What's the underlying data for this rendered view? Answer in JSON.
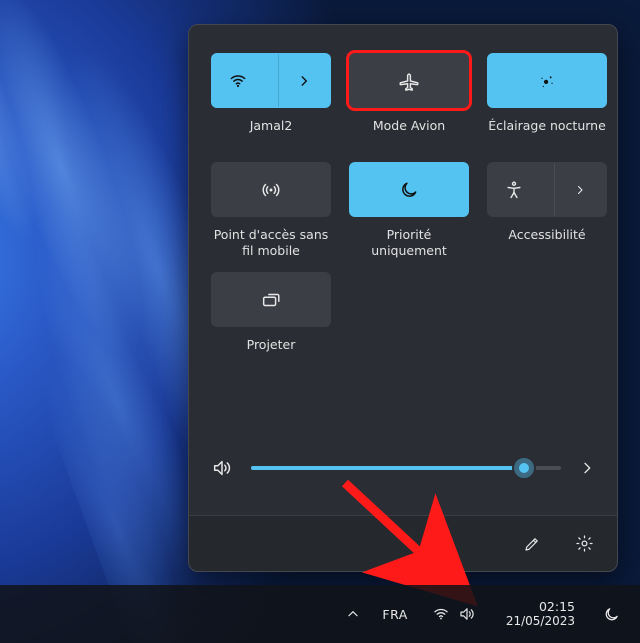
{
  "taskbar": {
    "language": "FRA",
    "clock": {
      "time": "02:15",
      "date": "21/05/2023"
    }
  },
  "quick_settings": {
    "tiles": [
      {
        "id": "wifi",
        "label": "Jamal2",
        "active": true,
        "split": true,
        "highlighted": false,
        "icon": "wifi-icon"
      },
      {
        "id": "airplane",
        "label": "Mode Avion",
        "active": false,
        "split": false,
        "highlighted": true,
        "icon": "airplane-icon"
      },
      {
        "id": "night-light",
        "label": "Éclairage nocturne",
        "active": true,
        "split": false,
        "highlighted": false,
        "icon": "night-light-icon"
      },
      {
        "id": "hotspot",
        "label": "Point d'accès sans fil mobile",
        "active": false,
        "split": false,
        "highlighted": false,
        "icon": "hotspot-icon"
      },
      {
        "id": "focus",
        "label": "Priorité uniquement",
        "active": true,
        "split": false,
        "highlighted": false,
        "icon": "moon-icon"
      },
      {
        "id": "accessibility",
        "label": "Accessibilité",
        "active": false,
        "split": true,
        "highlighted": false,
        "icon": "accessibility-icon"
      },
      {
        "id": "project",
        "label": "Projeter",
        "active": false,
        "split": false,
        "highlighted": false,
        "icon": "project-icon"
      }
    ],
    "volume_percent": 88
  }
}
